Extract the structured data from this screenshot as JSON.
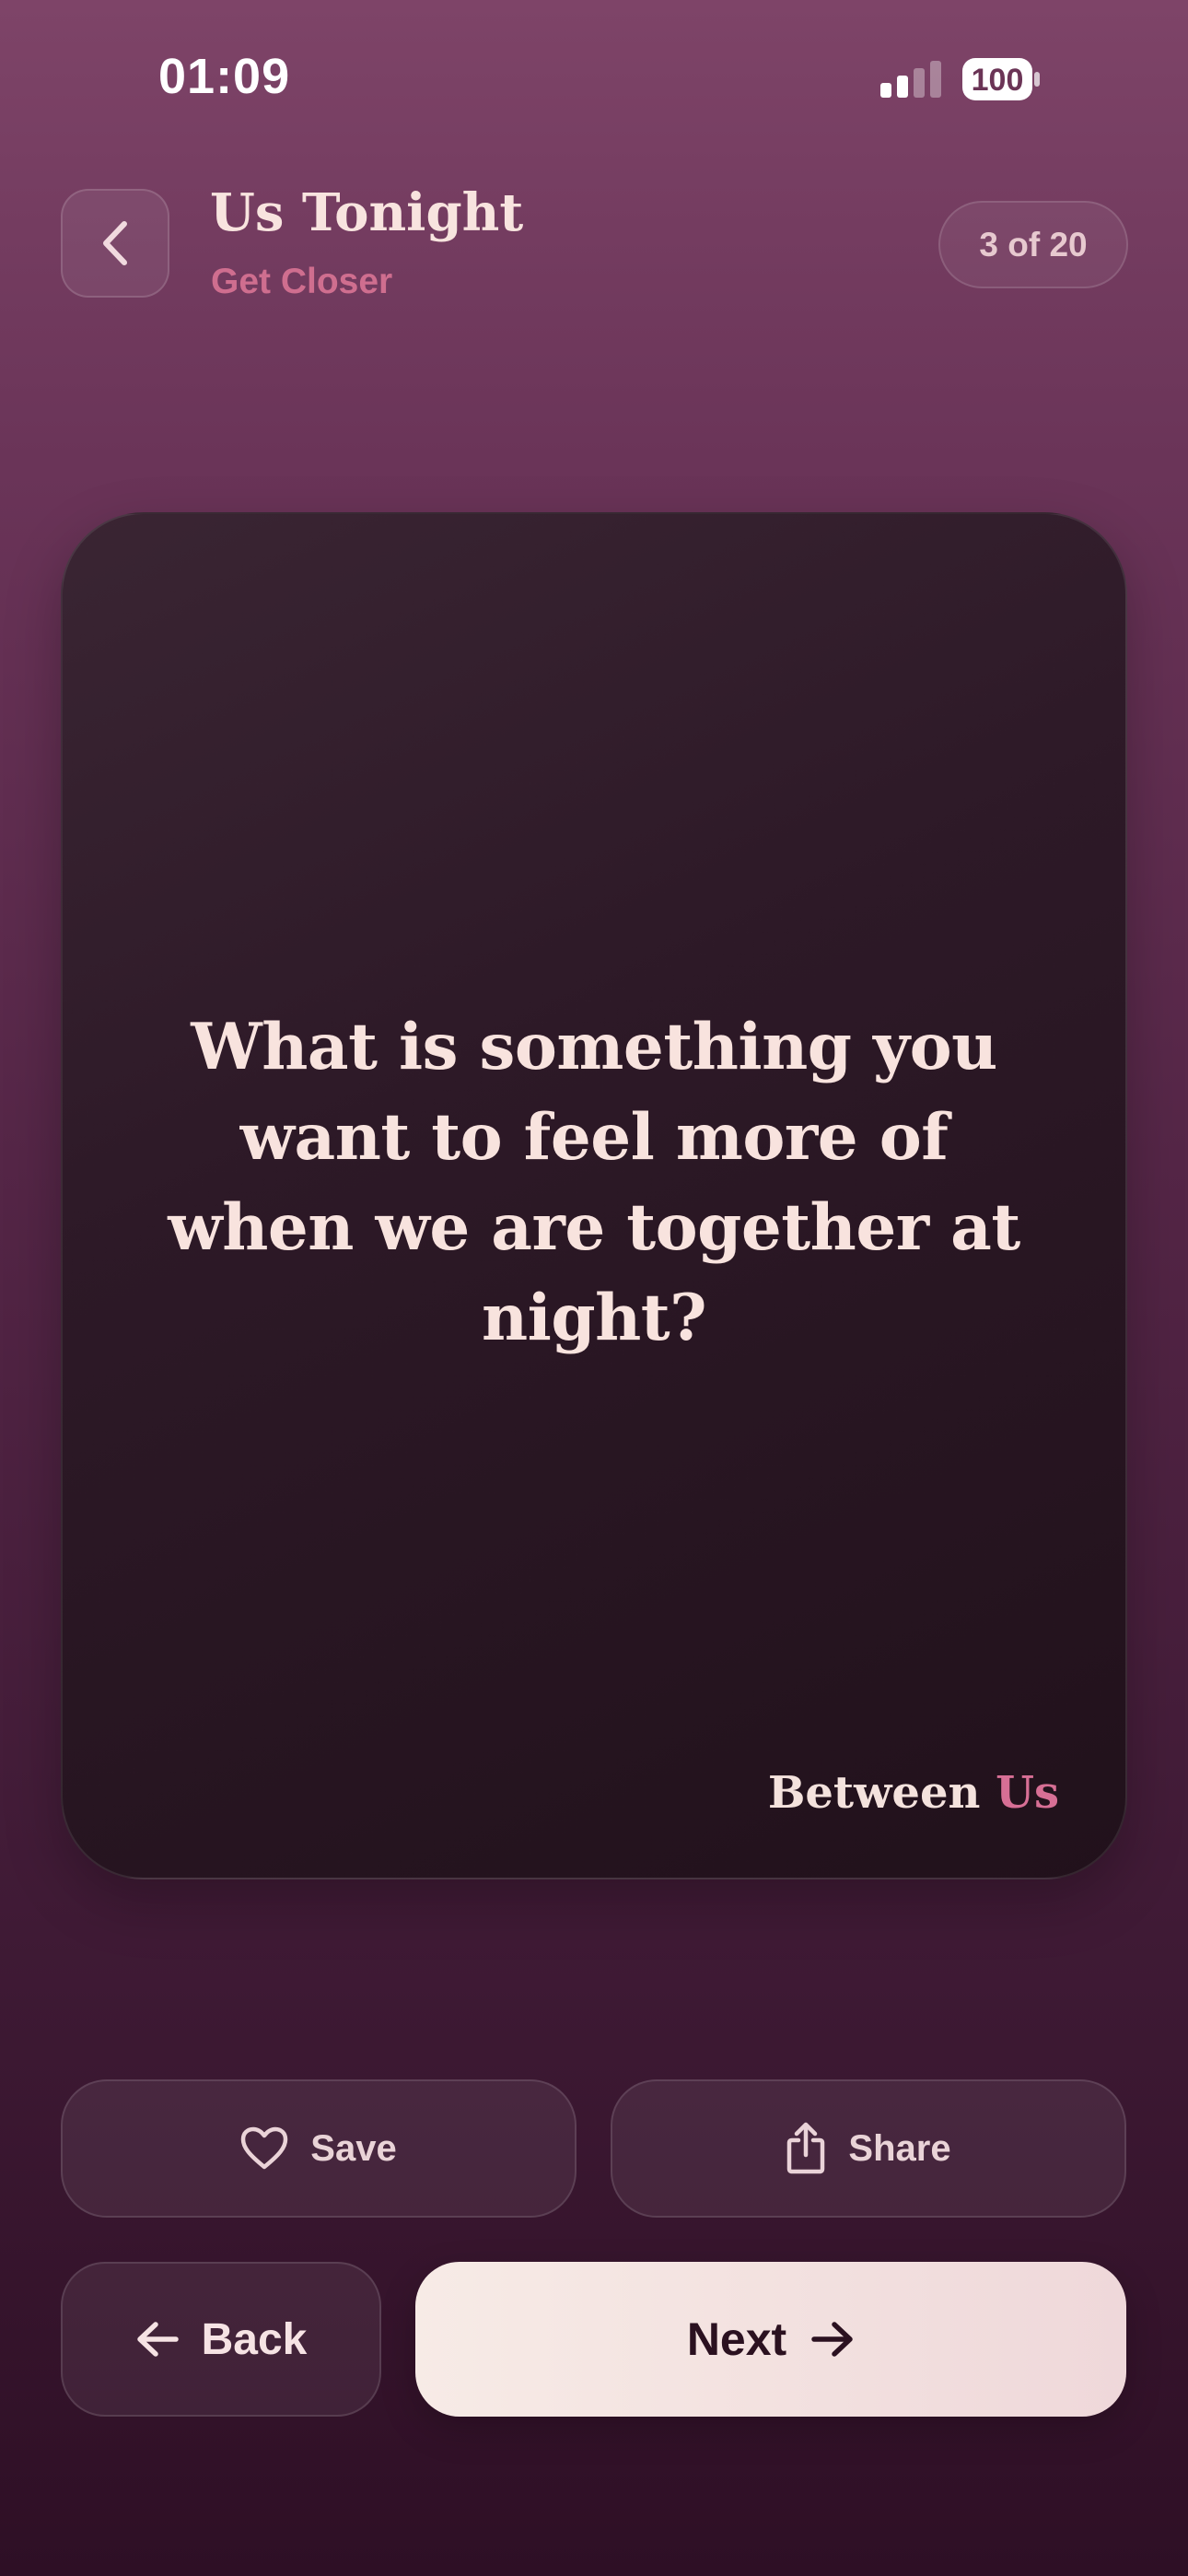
{
  "status_bar": {
    "time": "01:09",
    "battery": "100"
  },
  "header": {
    "title": "Us Tonight",
    "subtitle": "Get Closer",
    "progress": "3 of 20"
  },
  "card": {
    "question": "What is something you want to feel more of when we are together at night?",
    "brand_word1": "Between",
    "brand_word2": "Us"
  },
  "actions": {
    "save_label": "Save",
    "share_label": "Share",
    "back_label": "Back",
    "next_label": "Next"
  },
  "icons": {
    "back": "chevron-left-icon",
    "save": "heart-icon",
    "share": "share-icon",
    "back_arrow": "arrow-left-icon",
    "next_arrow": "arrow-right-icon"
  },
  "colors": {
    "accent": "#cf6e8f",
    "background_top": "#7e4468",
    "background_bottom": "#2e0f25",
    "card": "#2d1927",
    "next_button": "#f7ebe6"
  }
}
